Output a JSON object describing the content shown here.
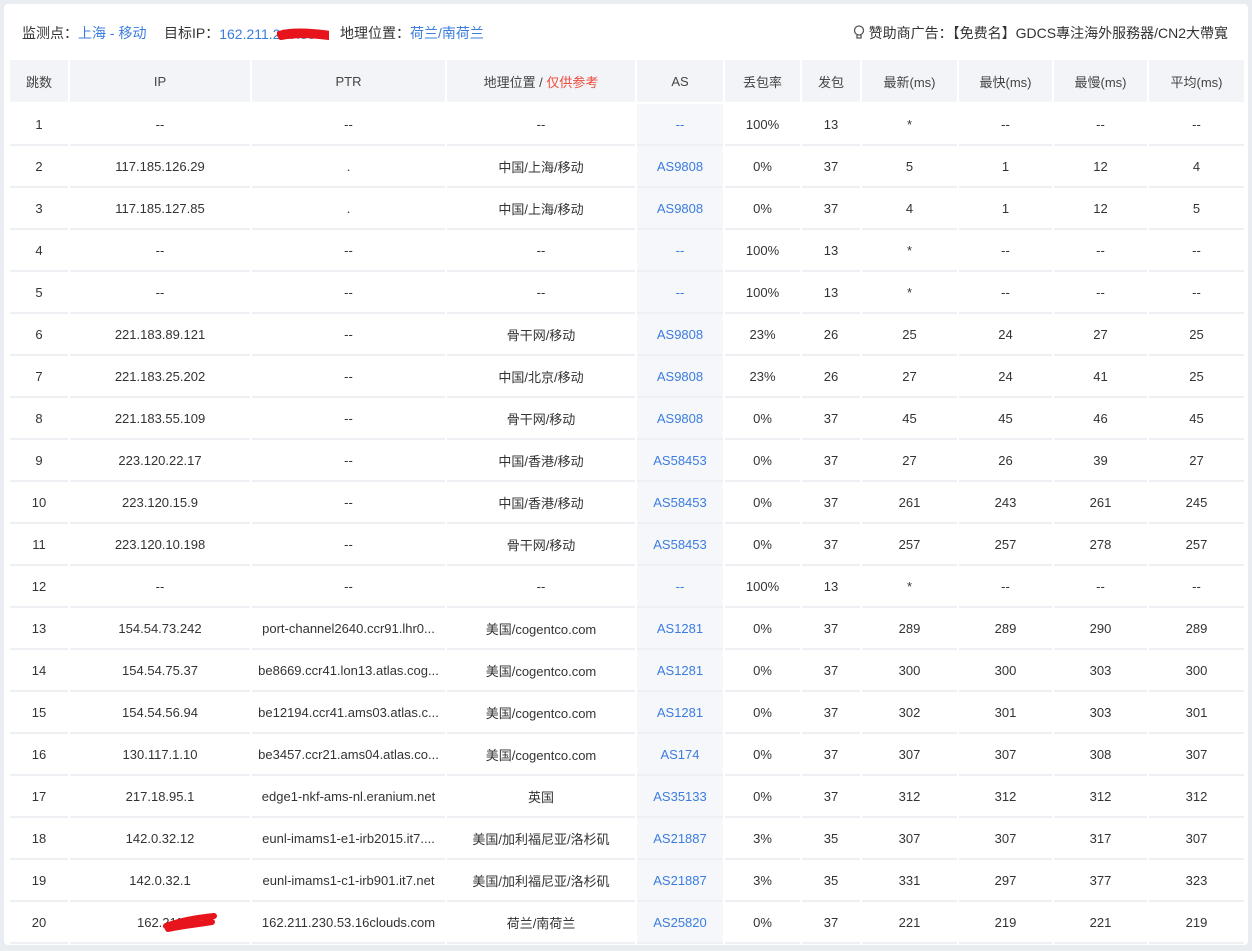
{
  "header": {
    "monitor_label": "监测点：",
    "monitor_value": "上海 - 移动",
    "target_label": "目标IP：",
    "target_value": "162.211.230.53",
    "geo_label": "地理位置：",
    "geo_value": "荷兰/南荷兰",
    "sponsor_label": "赞助商广告：",
    "sponsor_text": "【免费名】GDCS專注海外服務器/CN2大帶寬"
  },
  "colors": {
    "accent": "#3b7ddd",
    "warning": "#f04a3a",
    "redaction": "#e8141b"
  },
  "columns": {
    "hop": "跳数",
    "ip": "IP",
    "ptr": "PTR",
    "geo": "地理位置 / ",
    "geo_note": "仅供参考",
    "as": "AS",
    "loss": "丢包率",
    "sent": "发包",
    "last": "最新(ms)",
    "best": "最快(ms)",
    "worst": "最慢(ms)",
    "avg": "平均(ms)"
  },
  "rows": [
    {
      "hop": "1",
      "ip": "--",
      "ptr": "--",
      "geo": "--",
      "as": "--",
      "loss": "100%",
      "sent": "13",
      "last": "*",
      "best": "--",
      "worst": "--",
      "avg": "--"
    },
    {
      "hop": "2",
      "ip": "117.185.126.29",
      "ptr": ".",
      "geo": "中国/上海/移动",
      "as": "AS9808",
      "loss": "0%",
      "sent": "37",
      "last": "5",
      "best": "1",
      "worst": "12",
      "avg": "4"
    },
    {
      "hop": "3",
      "ip": "117.185.127.85",
      "ptr": ".",
      "geo": "中国/上海/移动",
      "as": "AS9808",
      "loss": "0%",
      "sent": "37",
      "last": "4",
      "best": "1",
      "worst": "12",
      "avg": "5"
    },
    {
      "hop": "4",
      "ip": "--",
      "ptr": "--",
      "geo": "--",
      "as": "--",
      "loss": "100%",
      "sent": "13",
      "last": "*",
      "best": "--",
      "worst": "--",
      "avg": "--"
    },
    {
      "hop": "5",
      "ip": "--",
      "ptr": "--",
      "geo": "--",
      "as": "--",
      "loss": "100%",
      "sent": "13",
      "last": "*",
      "best": "--",
      "worst": "--",
      "avg": "--"
    },
    {
      "hop": "6",
      "ip": "221.183.89.121",
      "ptr": "--",
      "geo": "骨干网/移动",
      "as": "AS9808",
      "loss": "23%",
      "sent": "26",
      "last": "25",
      "best": "24",
      "worst": "27",
      "avg": "25"
    },
    {
      "hop": "7",
      "ip": "221.183.25.202",
      "ptr": "--",
      "geo": "中国/北京/移动",
      "as": "AS9808",
      "loss": "23%",
      "sent": "26",
      "last": "27",
      "best": "24",
      "worst": "41",
      "avg": "25"
    },
    {
      "hop": "8",
      "ip": "221.183.55.109",
      "ptr": "--",
      "geo": "骨干网/移动",
      "as": "AS9808",
      "loss": "0%",
      "sent": "37",
      "last": "45",
      "best": "45",
      "worst": "46",
      "avg": "45"
    },
    {
      "hop": "9",
      "ip": "223.120.22.17",
      "ptr": "--",
      "geo": "中国/香港/移动",
      "as": "AS58453",
      "loss": "0%",
      "sent": "37",
      "last": "27",
      "best": "26",
      "worst": "39",
      "avg": "27"
    },
    {
      "hop": "10",
      "ip": "223.120.15.9",
      "ptr": "--",
      "geo": "中国/香港/移动",
      "as": "AS58453",
      "loss": "0%",
      "sent": "37",
      "last": "261",
      "best": "243",
      "worst": "261",
      "avg": "245"
    },
    {
      "hop": "11",
      "ip": "223.120.10.198",
      "ptr": "--",
      "geo": "骨干网/移动",
      "as": "AS58453",
      "loss": "0%",
      "sent": "37",
      "last": "257",
      "best": "257",
      "worst": "278",
      "avg": "257"
    },
    {
      "hop": "12",
      "ip": "--",
      "ptr": "--",
      "geo": "--",
      "as": "--",
      "loss": "100%",
      "sent": "13",
      "last": "*",
      "best": "--",
      "worst": "--",
      "avg": "--"
    },
    {
      "hop": "13",
      "ip": "154.54.73.242",
      "ptr": "port-channel2640.ccr91.lhr0...",
      "geo": "美国/cogentco.com",
      "as": "AS1281",
      "loss": "0%",
      "sent": "37",
      "last": "289",
      "best": "289",
      "worst": "290",
      "avg": "289"
    },
    {
      "hop": "14",
      "ip": "154.54.75.37",
      "ptr": "be8669.ccr41.lon13.atlas.cog...",
      "geo": "美国/cogentco.com",
      "as": "AS1281",
      "loss": "0%",
      "sent": "37",
      "last": "300",
      "best": "300",
      "worst": "303",
      "avg": "300"
    },
    {
      "hop": "15",
      "ip": "154.54.56.94",
      "ptr": "be12194.ccr41.ams03.atlas.c...",
      "geo": "美国/cogentco.com",
      "as": "AS1281",
      "loss": "0%",
      "sent": "37",
      "last": "302",
      "best": "301",
      "worst": "303",
      "avg": "301"
    },
    {
      "hop": "16",
      "ip": "130.117.1.10",
      "ptr": "be3457.ccr21.ams04.atlas.co...",
      "geo": "美国/cogentco.com",
      "as": "AS174",
      "loss": "0%",
      "sent": "37",
      "last": "307",
      "best": "307",
      "worst": "308",
      "avg": "307"
    },
    {
      "hop": "17",
      "ip": "217.18.95.1",
      "ptr": "edge1-nkf-ams-nl.eranium.net",
      "geo": "英国",
      "as": "AS35133",
      "loss": "0%",
      "sent": "37",
      "last": "312",
      "best": "312",
      "worst": "312",
      "avg": "312"
    },
    {
      "hop": "18",
      "ip": "142.0.32.12",
      "ptr": "eunl-imams1-e1-irb2015.it7....",
      "geo": "美国/加利福尼亚/洛杉矶",
      "as": "AS21887",
      "loss": "3%",
      "sent": "35",
      "last": "307",
      "best": "307",
      "worst": "317",
      "avg": "307"
    },
    {
      "hop": "19",
      "ip": "142.0.32.1",
      "ptr": "eunl-imams1-c1-irb901.it7.net",
      "geo": "美国/加利福尼亚/洛杉矶",
      "as": "AS21887",
      "loss": "3%",
      "sent": "35",
      "last": "331",
      "best": "297",
      "worst": "377",
      "avg": "323"
    },
    {
      "hop": "20",
      "ip": "162.211",
      "ptr": "162.211.230.53.16clouds.com",
      "geo": "荷兰/南荷兰",
      "as": "AS25820",
      "loss": "0%",
      "sent": "37",
      "last": "221",
      "best": "219",
      "worst": "221",
      "avg": "219"
    }
  ]
}
